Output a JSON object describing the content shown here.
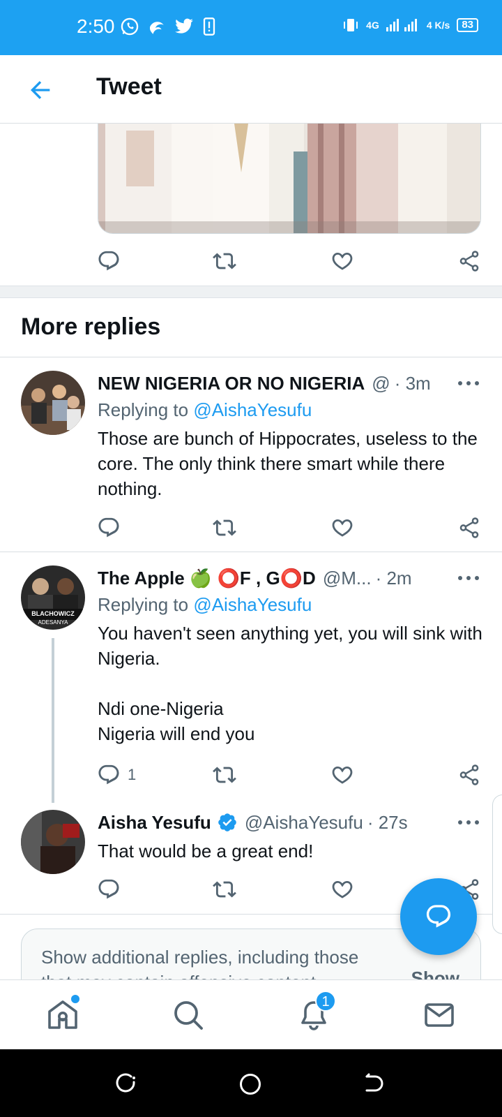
{
  "status_bar": {
    "time": "2:50",
    "network": "4G",
    "speed": "4 K/s",
    "battery": "83"
  },
  "header": {
    "title": "Tweet"
  },
  "section": {
    "more_replies": "More replies"
  },
  "replies": [
    {
      "name": "NEW NIGERIA OR NO NIGERIA",
      "handle": "@",
      "time": "· 3m",
      "replying_prefix": "Replying to",
      "replying_to": "@AishaYesufu",
      "text": "Those are bunch of Hippocrates, useless to the core. The only think there smart while there nothing.",
      "reply_count": ""
    },
    {
      "name": "The Apple 🍏 ⭕F , G⭕D",
      "handle": "@M...",
      "time": "· 2m",
      "replying_prefix": "Replying to",
      "replying_to": "@AishaYesufu",
      "text": "You haven't seen anything yet, you will sink with Nigeria.\n\nNdi one-Nigeria\nNigeria will end you",
      "reply_count": "1"
    },
    {
      "name": "Aisha Yesufu",
      "verified": true,
      "handle": "@AishaYesufu",
      "time": "· 27s",
      "text": "That would be a great end!",
      "reply_count": ""
    }
  ],
  "show_more": {
    "text": "Show additional replies, including those that may contain offensive content",
    "button": "Show"
  },
  "bottom_nav": {
    "notifications_badge": "1"
  },
  "colors": {
    "accent": "#1d9bf0",
    "status_bar": "#1da1f2"
  },
  "icons": [
    "back-arrow-icon",
    "reply-icon",
    "retweet-icon",
    "like-icon",
    "share-icon",
    "more-icon",
    "verified-icon",
    "compose-icon",
    "home-icon",
    "search-icon",
    "bell-icon",
    "mail-icon"
  ]
}
